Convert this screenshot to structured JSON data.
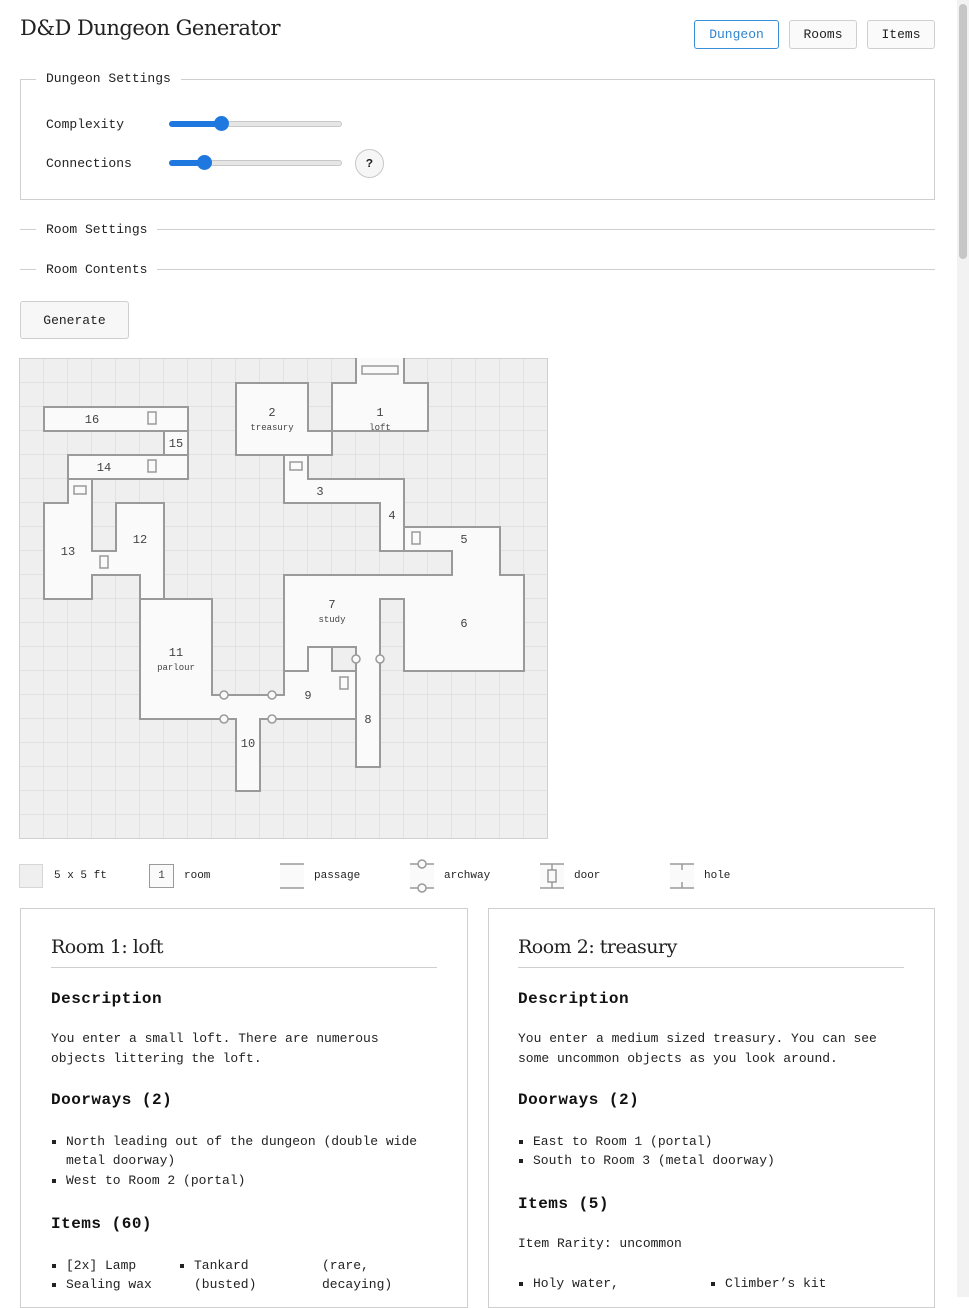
{
  "app": {
    "title": "D&D Dungeon Generator"
  },
  "nav": {
    "dungeon": "Dungeon",
    "rooms": "Rooms",
    "items": "Items"
  },
  "dungeon_settings": {
    "legend": "Dungeon Settings",
    "complexity_label": "Complexity",
    "complexity_value": 0.3,
    "connections_label": "Connections",
    "connections_value": 0.2,
    "help": "?"
  },
  "room_settings": {
    "legend": "Room Settings"
  },
  "room_contents": {
    "legend": "Room Contents"
  },
  "generate_label": "Generate",
  "map": {
    "rooms": [
      {
        "num": "1",
        "name": "loft"
      },
      {
        "num": "2",
        "name": "treasury"
      },
      {
        "num": "3",
        "name": ""
      },
      {
        "num": "4",
        "name": ""
      },
      {
        "num": "5",
        "name": ""
      },
      {
        "num": "6",
        "name": ""
      },
      {
        "num": "7",
        "name": "study"
      },
      {
        "num": "8",
        "name": ""
      },
      {
        "num": "9",
        "name": ""
      },
      {
        "num": "10",
        "name": ""
      },
      {
        "num": "11",
        "name": "parlour"
      },
      {
        "num": "12",
        "name": ""
      },
      {
        "num": "13",
        "name": ""
      },
      {
        "num": "14",
        "name": ""
      },
      {
        "num": "15",
        "name": ""
      },
      {
        "num": "16",
        "name": ""
      }
    ]
  },
  "map_legend": {
    "grid": "5 x 5 ft",
    "room_num": "1",
    "room": "room",
    "passage": "passage",
    "archway": "archway",
    "door": "door",
    "hole": "hole"
  },
  "rooms": [
    {
      "title": "Room 1: loft",
      "description_heading": "Description",
      "description": "You enter a small loft. There are numerous objects littering the loft.",
      "doorways_heading": "Doorways (2)",
      "doorways": [
        "North leading out of the dungeon (double wide metal doorway)",
        "West to Room 2 (portal)"
      ],
      "items_heading": "Items (60)",
      "items_col1": [
        "[2x] Lamp",
        "Sealing wax"
      ],
      "items_col2_line1": "Tankard",
      "items_col2_line2": "(busted)",
      "items_col3_line1": "(rare,",
      "items_col3_line2": "decaying)"
    },
    {
      "title": "Room 2: treasury",
      "description_heading": "Description",
      "description": "You enter a medium sized treasury. You can see some uncommon objects as you look around.",
      "doorways_heading": "Doorways (2)",
      "doorways": [
        "East to Room 1 (portal)",
        "South to Room 3 (metal doorway)"
      ],
      "items_heading": "Items (5)",
      "rarity": "Item Rarity: uncommon",
      "items_col1": [
        "Holy water,"
      ],
      "items_col2": [
        "Climber’s kit"
      ]
    }
  ]
}
